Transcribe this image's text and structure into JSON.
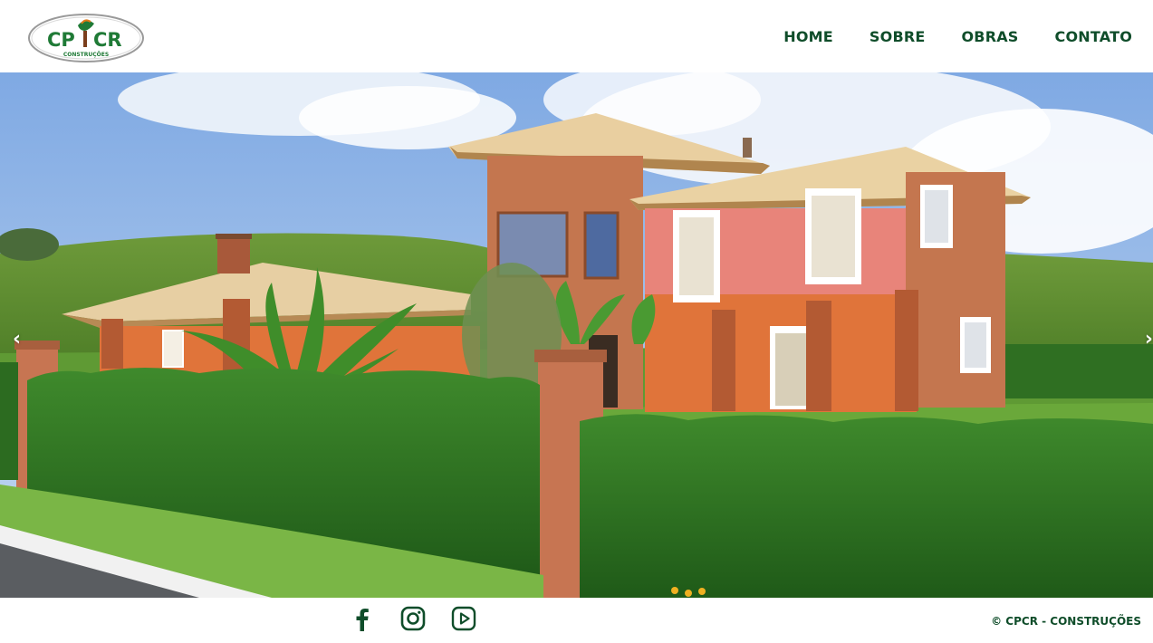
{
  "header": {
    "logo": {
      "text_left": "CP",
      "text_right": "CR",
      "subtext": "CONSTRUÇÕES"
    },
    "nav": [
      {
        "label": "HOME"
      },
      {
        "label": "SOBRE"
      },
      {
        "label": "OBRAS"
      },
      {
        "label": "CONTATO"
      }
    ]
  },
  "carousel": {
    "prev_label": "‹",
    "next_label": "›"
  },
  "footer": {
    "social": [
      {
        "icon": "facebook-icon"
      },
      {
        "icon": "instagram-icon"
      },
      {
        "icon": "youtube-icon"
      }
    ],
    "copyright": "© CPCR - CONSTRUÇÕES"
  },
  "colors": {
    "brand_green": "#0f4d2a",
    "logo_green": "#1f7a36",
    "logo_tree_brown": "#7a3e1c",
    "logo_orange": "#e07a18"
  }
}
